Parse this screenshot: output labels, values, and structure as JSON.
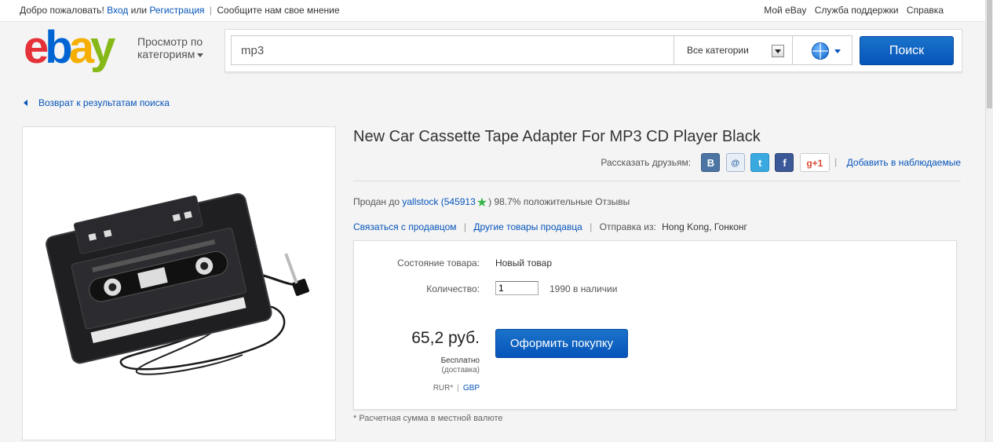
{
  "topbar": {
    "welcome": "Добро пожаловать!",
    "login": "Вход",
    "or": "или",
    "register": "Регистрация",
    "feedback": "Сообщите нам свое мнение",
    "my_ebay": "Мой eBay",
    "support": "Служба поддержки",
    "help": "Справка"
  },
  "header": {
    "logo": {
      "e": "e",
      "b": "b",
      "a": "a",
      "y": "y"
    },
    "browse_label": "Просмотр по категориям",
    "search_value": "mp3",
    "category": "Все категории",
    "search_button": "Поиск"
  },
  "back_link": "Возврат к результатам поиска",
  "product": {
    "title": "New Car Cassette Tape Adapter For MP3 CD Player Black",
    "share_label": "Рассказать друзьям:",
    "social": {
      "vk": "B",
      "mailru": "@",
      "twitter": "t",
      "facebook": "f",
      "gplus": "g+1"
    },
    "watch": "Добавить в наблюдаемые",
    "seller_prefix": "Продан до",
    "seller_name": "yallstock",
    "seller_score": "(545913",
    "seller_rating": ") 98.7% положительные Отзывы",
    "contact_seller": "Связаться с продавцом",
    "other_items": "Другие товары продавца",
    "ships_from_label": "Отправка из:",
    "ships_from": "Hong Kong, Гонконг",
    "condition_label": "Состояние товара:",
    "condition": "Новый товар",
    "quantity_label": "Количество:",
    "quantity": "1",
    "available": "1990 в наличии",
    "price": "65,2 руб.",
    "shipping_free": "Бесплатно",
    "shipping_sub": "(доставка)",
    "currency_rur": "RUR*",
    "currency_gbp": "GBP",
    "buy_button": "Оформить покупку",
    "footnote": "* Расчетная сумма в местной валюте"
  },
  "colors": {
    "link": "#0654ba",
    "button": "#0654ba",
    "logo_e": "#e53238",
    "logo_b": "#0064d2",
    "logo_a": "#f5af02",
    "logo_y": "#86b817",
    "star": "#38b54a"
  }
}
